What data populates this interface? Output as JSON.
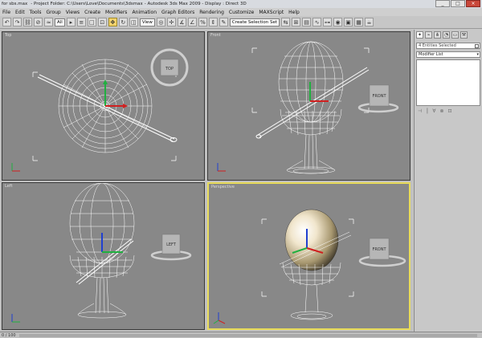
{
  "titlebar": {
    "file": "for sbs.max",
    "project": "- Project Folder: C:\\Users\\Love\\Documents\\3dsmax",
    "app": "- Autodesk 3ds Max 2009 - Display : Direct 3D",
    "buttons": [
      "_",
      "□",
      "×"
    ]
  },
  "menu": [
    "File",
    "Edit",
    "Tools",
    "Group",
    "Views",
    "Create",
    "Modifiers",
    "Animation",
    "Graph Editors",
    "Rendering",
    "Customize",
    "MAXScript",
    "Help"
  ],
  "toolbar": {
    "filter": "All",
    "ref_coord": "View",
    "selection_set": "Create Selection Set"
  },
  "viewports": [
    {
      "label": "Top",
      "cube": "TOP"
    },
    {
      "label": "Front",
      "cube": "FRONT"
    },
    {
      "label": "Left",
      "cube": "LEFT"
    },
    {
      "label": "Perspective",
      "cube": "FRONT"
    }
  ],
  "command_panel": {
    "tabs": [
      "create",
      "modify",
      "hierarchy",
      "motion",
      "display",
      "utilities"
    ],
    "selection_name": "4 Entities Selected",
    "modifier_list": "Modifier List",
    "stack_buttons": [
      "⊣",
      "⎮",
      "∀",
      "⊗",
      "⊡"
    ]
  },
  "status": {
    "frame": "0 / 100"
  },
  "colors": {
    "viewport_bg": "#888888",
    "active_border": "#e9dc5a",
    "wire": "#ffffff",
    "axis_x": "#d02020",
    "axis_y": "#20b040",
    "axis_z": "#2040d0"
  }
}
